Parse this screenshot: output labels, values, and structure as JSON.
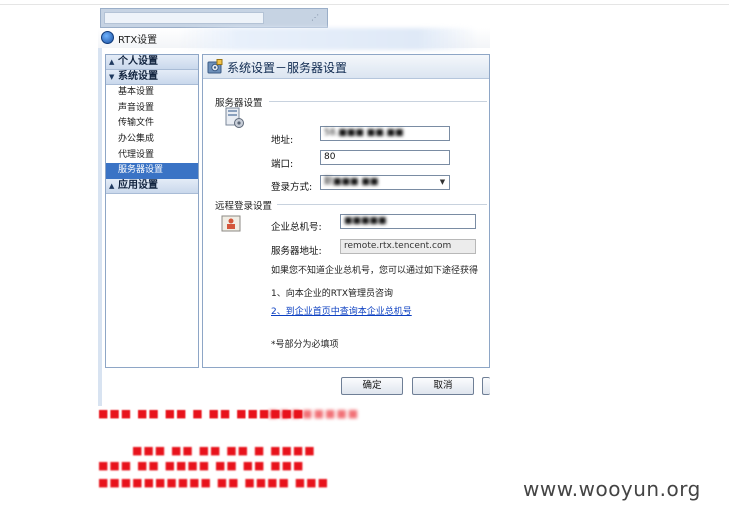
{
  "window": {
    "title": "RTX设置"
  },
  "sidebar": {
    "groups": [
      {
        "label": "个人设置",
        "arrow": "▲"
      },
      {
        "label": "系统设置",
        "arrow": "▼"
      },
      {
        "label": "应用设置",
        "arrow": "▲"
      }
    ],
    "system_items": [
      {
        "label": "基本设置"
      },
      {
        "label": "声音设置"
      },
      {
        "label": "传输文件"
      },
      {
        "label": "办公集成"
      },
      {
        "label": "代理设置"
      },
      {
        "label": "服务器设置",
        "selected": true
      }
    ]
  },
  "main": {
    "header_title": "系统设置－服务器设置",
    "server_section": {
      "title": "服务器设置",
      "address_label": "地址:",
      "address_value": "58.■■■ ■■.■■",
      "port_label": "端口:",
      "port_value": "80",
      "login_label": "登录方式:",
      "login_value": "默■■■ ■■"
    },
    "remote_section": {
      "title": "远程登录设置",
      "enterprise_label": "企业总机号:",
      "enterprise_value": "■■■■■",
      "server_label": "服务器地址:",
      "server_value": "remote.rtx.tencent.com",
      "hint": "如果您不知道企业总机号，您可以通过如下途径获得",
      "tip1": "1、向本企业的RTX管理员咨询",
      "tip2": "2、到企业首页中查询本企业总机号",
      "required_note": "*号部分为必填项"
    }
  },
  "buttons": {
    "ok": "确定",
    "cancel": "取消"
  },
  "redacted_lines": [
    "■■■ ■■ ■■ ■ ■■ ■■■■■■",
    "■■■■■■■■",
    "■■■ ■■ ■■ ■■ ■ ■■■■",
    "■■■ ■■ ■■■■ ■■ ■■ ■■■",
    "■■■■■■■■■■ ■■ ■■■■ ■■■"
  ],
  "watermark": "www.wooyun.org",
  "colors": {
    "selected_item": "#3a73c5",
    "link": "#0b3fc1",
    "redaction": "#e8121b"
  }
}
